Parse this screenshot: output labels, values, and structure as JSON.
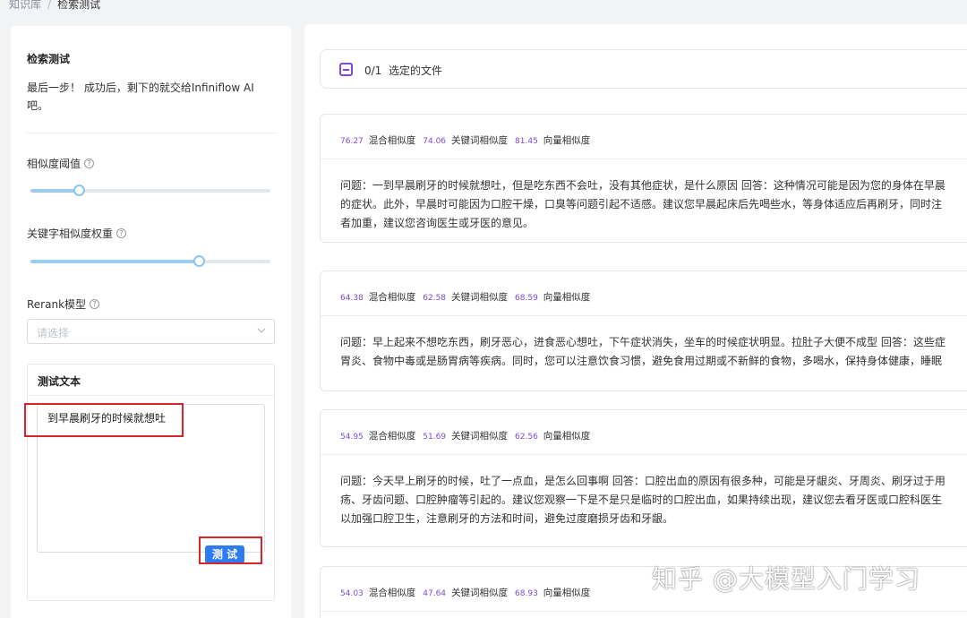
{
  "breadcrumb": {
    "root": "知识库",
    "separator": "/",
    "current": "检索测试"
  },
  "left_panel": {
    "title": "检索测试",
    "description_line1": "最后一步！ 成功后，剩下的就交给Infiniflow AI",
    "description_line2": "吧。",
    "similarity_threshold": {
      "label": "相似度阈值",
      "help_icon": "question-circle-icon",
      "value_fraction": 0.2
    },
    "keyword_weight": {
      "label": "关键字相似度权重",
      "help_icon": "question-circle-icon",
      "value_fraction": 0.7
    },
    "rerank": {
      "label": "Rerank模型",
      "help_icon": "question-circle-icon",
      "placeholder": "请选择"
    },
    "test_text": {
      "title": "测试文本",
      "value": "到早晨刷牙的时候就想吐",
      "button_label": "测 试"
    }
  },
  "file_bar": {
    "count": "0/1",
    "label": "选定的文件"
  },
  "results": [
    {
      "hybrid_score": "76.27",
      "hybrid_label": "混合相似度",
      "keyword_score": "74.06",
      "keyword_label": "关键词相似度",
      "vector_score": "81.45",
      "vector_label": "向量相似度",
      "lines": [
        "问题：一到早晨刷牙的时候就想吐，但是吃东西不会吐，没有其他症状，是什么原因 回答：这种情况可能是因为您的身体在早晨",
        "的症状。此外，早晨时可能因为口腔干燥，口臭等问题引起不适感。建议您早晨起床后先喝些水，等身体适应后再刷牙，同时注",
        "者加重，建议您咨询医生或牙医的意见。"
      ]
    },
    {
      "hybrid_score": "64.38",
      "hybrid_label": "混合相似度",
      "keyword_score": "62.58",
      "keyword_label": "关键词相似度",
      "vector_score": "68.59",
      "vector_label": "向量相似度",
      "lines": [
        "问题：早上起来不想吃东西，刷牙恶心，进食恶心想吐，下午症状消失，坐车的时候症状明显。拉肚子大便不成型 回答：这些症",
        "胃炎、食物中毒或是肠胃病等疾病。同时，您可以注意饮食习惯，避免食用过期或不新鲜的食物，多喝水，保持身体健康，睡眠"
      ]
    },
    {
      "hybrid_score": "54.95",
      "hybrid_label": "混合相似度",
      "keyword_score": "51.69",
      "keyword_label": "关键词相似度",
      "vector_score": "62.56",
      "vector_label": "向量相似度",
      "lines": [
        "问题：今天早上刷牙的时候，吐了一点血，是怎么回事啊 回答：口腔出血的原因有很多种，可能是牙龈炎、牙周炎、刷牙过于用",
        "疡、牙齿问题、口腔肿瘤等引起的。建议您观察一下是不是只是临时的口腔出血，如果持续出现，建议您去看牙医或口腔科医生",
        "以加强口腔卫生，注意刷牙的方法和时间，避免过度磨损牙齿和牙龈。"
      ]
    },
    {
      "hybrid_score": "54.03",
      "hybrid_label": "混合相似度",
      "keyword_score": "47.64",
      "keyword_label": "关键词相似度",
      "vector_score": "68.93",
      "vector_label": "向量相似度",
      "lines": []
    }
  ],
  "watermark": "知乎 @大模型入门学习",
  "colors": {
    "accent_purple": "#7b4ad8",
    "button_blue": "#2d7cf2",
    "slider_fill": "#9ccdf0",
    "highlight_red": "#d7252c"
  }
}
